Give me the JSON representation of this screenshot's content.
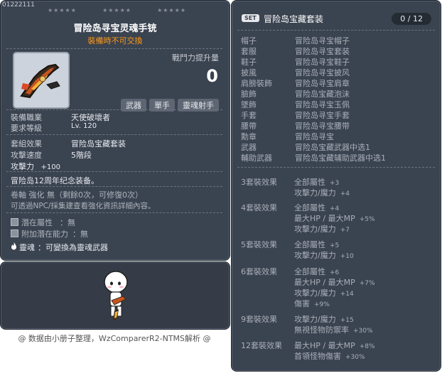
{
  "item": {
    "code": "01222111",
    "title": "冒险岛寻宝灵魂手铳",
    "subtitle": "裝備時不可交換",
    "power_label": "戰鬥力提升量",
    "power_value": "0",
    "tags": [
      "武器",
      "單手",
      "靈魂射手"
    ],
    "job_label": "裝備職業",
    "job_value": "天使破壞者",
    "level_label": "要求等級",
    "level_value": "Lv. 120",
    "set_label": "套組效果",
    "set_value": "冒险岛宝藏套装",
    "speed_label": "攻擊速度",
    "speed_value": "5階段",
    "attack_label": "攻擊力",
    "attack_value": "+100",
    "desc": "冒险岛12周年纪念装备。",
    "scroll_line": "卷軸 強化 無（剩餘0次，可修復0次）",
    "npc_line": "可透過NPC/採集建查看強化資訊詳細內容。",
    "potential_label": "潛在屬性",
    "potential_value": "：無",
    "add_potential_label": "附加潛在能力",
    "add_potential_value": "：無",
    "soul_label": "靈魂",
    "soul_value": "：可變換為靈魂武器"
  },
  "credit": "@ 数据由小册子整理，WzComparerR2-NTMS解析 @",
  "set": {
    "badge": "SET",
    "name": "冒险岛宝藏套装",
    "count": "0 / 12",
    "pieces": [
      {
        "slot": "帽子",
        "name": "冒险岛寻宝帽子"
      },
      {
        "slot": "套服",
        "name": "冒险岛寻宝套装"
      },
      {
        "slot": "鞋子",
        "name": "冒险岛寻宝鞋子"
      },
      {
        "slot": "披風",
        "name": "冒险岛寻宝披风"
      },
      {
        "slot": "肩膀裝飾",
        "name": "冒险岛寻宝肩章"
      },
      {
        "slot": "臉飾",
        "name": "冒险岛宝藏泡沫"
      },
      {
        "slot": "墜飾",
        "name": "冒险岛寻宝玉佩"
      },
      {
        "slot": "手套",
        "name": "冒险岛寻宝手套"
      },
      {
        "slot": "腰帶",
        "name": "冒险岛寻宝腰带"
      },
      {
        "slot": "勳章",
        "name": "冒险岛寻宝"
      },
      {
        "slot": "武器",
        "name": "冒险岛宝藏武器中选1"
      },
      {
        "slot": "輔助武器",
        "name": "冒险岛宝藏辅助武器中选1"
      }
    ],
    "effects": [
      {
        "label": "3套裝效果",
        "lines": [
          {
            "text": "全部屬性",
            "val": "+3"
          },
          {
            "text": "攻擊力/魔力",
            "val": "+4"
          }
        ]
      },
      {
        "label": "4套裝效果",
        "lines": [
          {
            "text": "全部屬性",
            "val": "+4"
          },
          {
            "text": "最大HP / 最大MP",
            "val": "+5%"
          },
          {
            "text": "攻擊力/魔力",
            "val": "+7"
          }
        ]
      },
      {
        "label": "5套裝效果",
        "lines": [
          {
            "text": "全部屬性",
            "val": "+5"
          },
          {
            "text": "攻擊力/魔力",
            "val": "+10"
          }
        ]
      },
      {
        "label": "6套裝效果",
        "lines": [
          {
            "text": "全部屬性",
            "val": "+6"
          },
          {
            "text": "最大HP / 最大MP",
            "val": "+7%"
          },
          {
            "text": "攻擊力/魔力",
            "val": "+14"
          },
          {
            "text": "傷害",
            "val": "+9%"
          }
        ]
      },
      {
        "label": "9套裝效果",
        "lines": [
          {
            "text": "攻擊力/魔力",
            "val": "+15"
          },
          {
            "text": "無視怪物防禦率",
            "val": "+30%"
          }
        ]
      },
      {
        "label": "12套裝效果",
        "lines": [
          {
            "text": "最大HP / 最大MP",
            "val": "+8%"
          },
          {
            "text": "首領怪物傷害",
            "val": "+30%"
          }
        ]
      }
    ]
  }
}
